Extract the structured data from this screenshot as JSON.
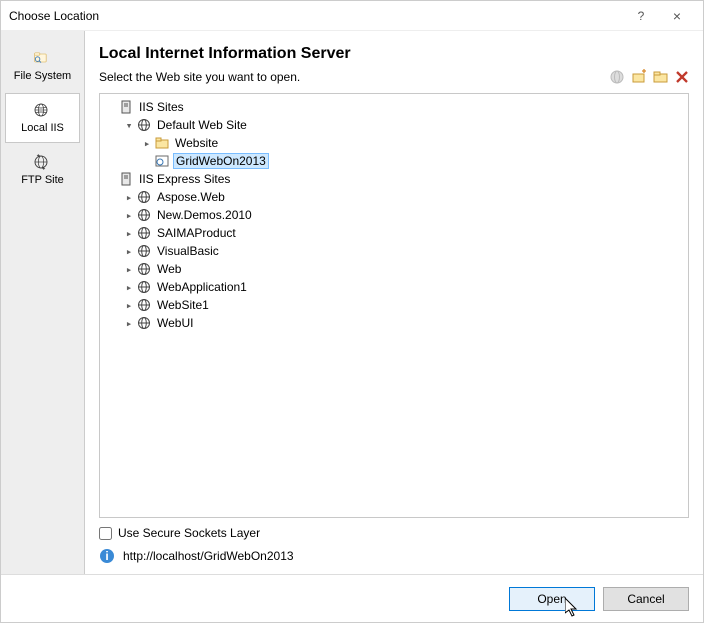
{
  "window": {
    "title": "Choose Location",
    "help": "?",
    "close": "×"
  },
  "sidebar": {
    "items": [
      {
        "label": "File System"
      },
      {
        "label": "Local IIS"
      },
      {
        "label": "FTP Site"
      }
    ],
    "selected": 1
  },
  "main": {
    "heading": "Local Internet Information Server",
    "subtext": "Select the Web site you want to open."
  },
  "tree": {
    "root1": "IIS Sites",
    "default_site": "Default Web Site",
    "website": "Website",
    "selected_node": "GridWebOn2013",
    "root2": "IIS Express Sites",
    "express": [
      "Aspose.Web",
      "New.Demos.2010",
      "SAIMAProduct",
      "VisualBasic",
      "Web",
      "WebApplication1",
      "WebSite1",
      "WebUI"
    ]
  },
  "ssl": {
    "label": "Use Secure Sockets Layer",
    "checked": false
  },
  "info": {
    "url": "http://localhost/GridWebOn2013"
  },
  "footer": {
    "open": "Open",
    "cancel": "Cancel"
  }
}
